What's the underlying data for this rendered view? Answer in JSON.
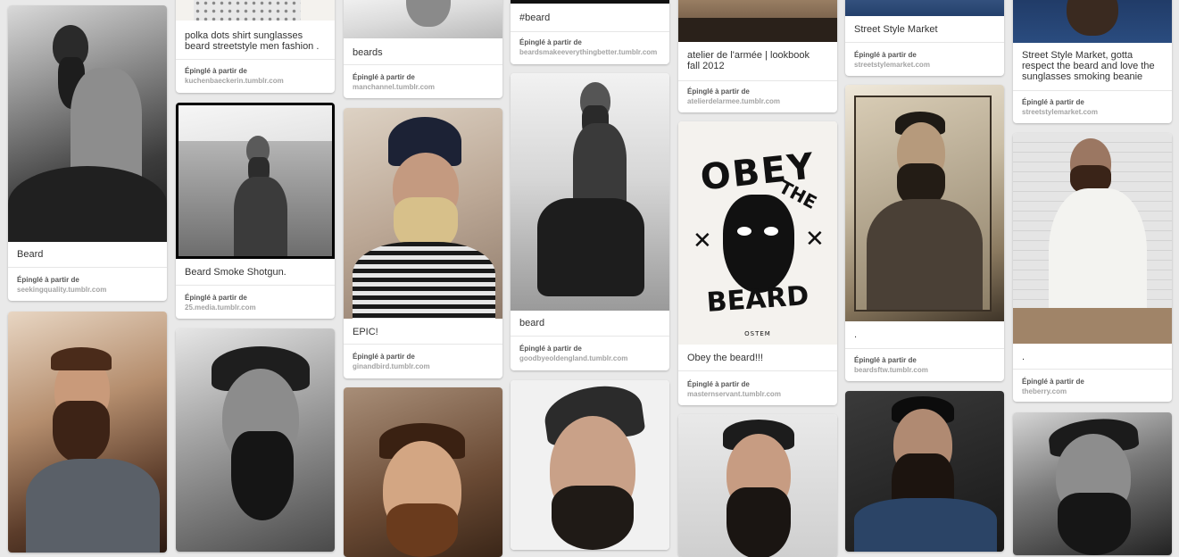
{
  "pins": {
    "c1p1": {
      "desc": "Beard",
      "label": "Épinglé à partir de",
      "url": "seekingquality.tumblr.com"
    },
    "c2p0": {
      "desc": "polka dots shirt sunglasses beard streetstyle men fashion .",
      "label": "Épinglé à partir de",
      "url": "kuchenbaeckerin.tumblr.com"
    },
    "c2p1": {
      "desc": "Beard Smoke Shotgun.",
      "label": "Épinglé à partir de",
      "url": "25.media.tumblr.com"
    },
    "c3p0": {
      "desc": "beards",
      "label": "Épinglé à partir de",
      "url": "manchannel.tumblr.com"
    },
    "c3p1": {
      "desc": "EPIC!",
      "label": "Épinglé à partir de",
      "url": "ginandbird.tumblr.com"
    },
    "c4p0": {
      "desc": "#beard",
      "label": "Épinglé à partir de",
      "url": "beardsmakeeverythingbetter.tumblr.com"
    },
    "c4p1": {
      "desc": "beard",
      "label": "Épinglé à partir de",
      "url": "goodbyeoldengland.tumblr.com"
    },
    "c5p0": {
      "desc": "atelier de l'armée | lookbook fall 2012",
      "label": "Épinglé à partir de",
      "url": "atelierdelarmee.tumblr.com"
    },
    "c5p1": {
      "desc": "Obey the beard!!!",
      "label": "Épinglé à partir de",
      "url": "masternservant.tumblr.com"
    },
    "c6p0": {
      "desc": "Street Style Market",
      "label": "Épinglé à partir de",
      "url": "streetstylemarket.com"
    },
    "c6p1": {
      "desc": ".",
      "label": "Épinglé à partir de",
      "url": "beardsftw.tumblr.com"
    },
    "c7p0": {
      "desc": "Street Style Market, gotta respect the beard and love the sunglasses smoking beanie",
      "label": "Épinglé à partir de",
      "url": "streetstylemarket.com"
    },
    "c7p1": {
      "desc": ".",
      "label": "Épinglé à partir de",
      "url": "theberry.com"
    }
  },
  "artwork": {
    "obey": "OBEY",
    "the": "THE",
    "beard": "BEARD",
    "brand": "OSTEM"
  },
  "colors": {
    "background": "#e9e9e9",
    "card": "#ffffff",
    "source_url": "#a3a3a3"
  }
}
